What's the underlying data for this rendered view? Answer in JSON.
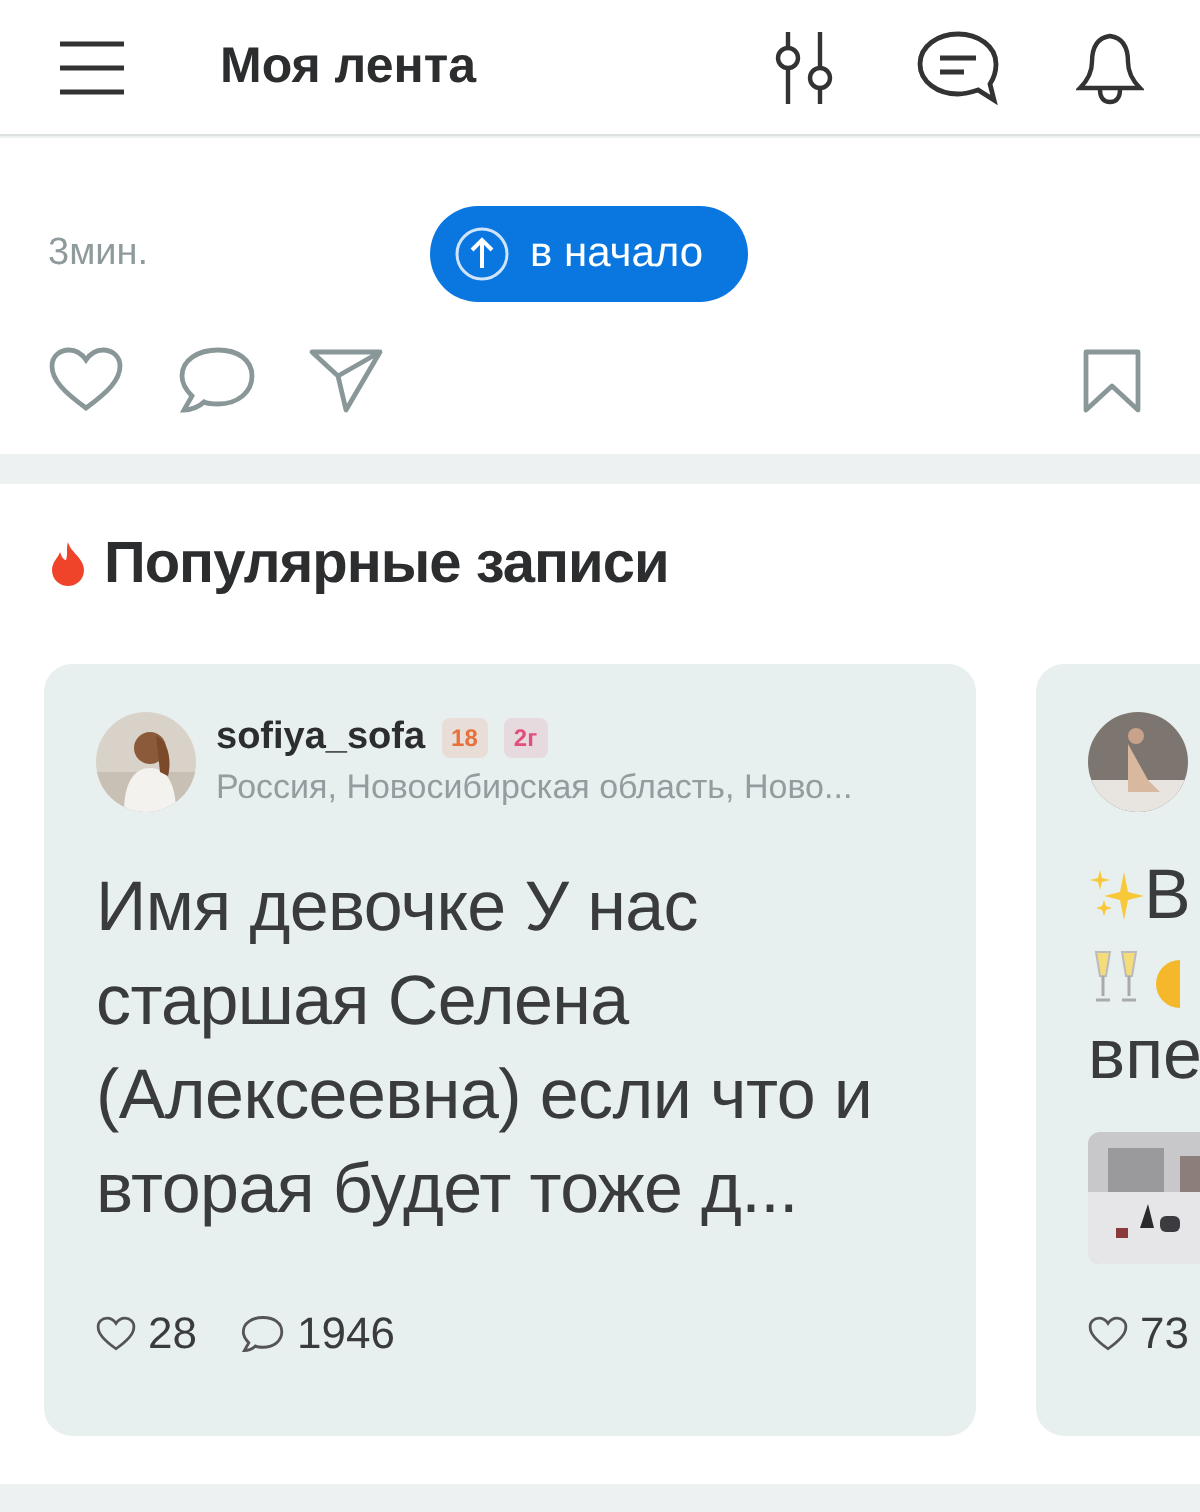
{
  "header": {
    "title": "Моя лента"
  },
  "post": {
    "time": "3мин.",
    "scroll_top_button": "в начало"
  },
  "popular": {
    "title": "Популярные записи",
    "cards": [
      {
        "kind": "text",
        "author": "sofiya_sofa",
        "badges": [
          {
            "text": "18",
            "color": "#e8703a"
          },
          {
            "text": "2г",
            "color": "#e0507a"
          }
        ],
        "location": "Россия, Новосибирская область, Ново...",
        "text": "Имя девочке У нас старшая Селена (Алексеевна) если что и вторая будет тоже д...",
        "likes": "28",
        "comments": "1946"
      },
      {
        "kind": "media",
        "lines": [
          "В",
          "впе"
        ],
        "likes": "73"
      }
    ]
  }
}
